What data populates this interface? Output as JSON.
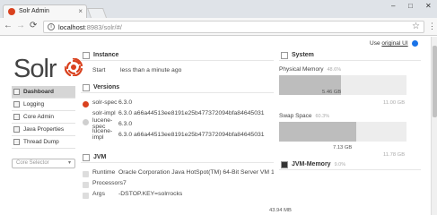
{
  "browser": {
    "tab_title": "Solr Admin",
    "tab_close": "×",
    "win_min": "–",
    "win_max": "□",
    "win_close": "✕",
    "url_host": "localhost",
    "url_path": ":8983/solr/#/",
    "back": "←",
    "forward": "→",
    "reload": "⟳",
    "star": "☆",
    "menu": "⋮",
    "info": "i"
  },
  "header": {
    "use_prefix": "Use ",
    "use_link": "original UI"
  },
  "logo": {
    "text": "Solr"
  },
  "nav": {
    "items": [
      {
        "label": "Dashboard",
        "icon": "dashboard-icon"
      },
      {
        "label": "Logging",
        "icon": "logging-icon"
      },
      {
        "label": "Core Admin",
        "icon": "core-admin-icon"
      },
      {
        "label": "Java Properties",
        "icon": "java-properties-icon"
      },
      {
        "label": "Thread Dump",
        "icon": "thread-dump-icon"
      }
    ],
    "core_selector": "Core Selector",
    "core_selector_arrow": "▾"
  },
  "instance": {
    "title": "Instance",
    "start_label": "Start",
    "start_value": "less than a minute ago"
  },
  "versions": {
    "title": "Versions",
    "rows": [
      {
        "label": "solr-spec",
        "value": "6.3.0"
      },
      {
        "label": "solr-impl",
        "value": "6.3.0 a66a44513ee8191e25b477372094bfa84645031"
      },
      {
        "label": "lucene-spec",
        "value": "6.3.0"
      },
      {
        "label": "lucene-impl",
        "value": "6.3.0 a66a44513ee8191e25b477372094bfa84645031"
      }
    ]
  },
  "jvm": {
    "title": "JVM",
    "rows": [
      {
        "label": "Runtime",
        "value": "Oracle Corporation Java HotSpot(TM) 64-Bit Server VM 1"
      },
      {
        "label": "Processors",
        "value": "7"
      },
      {
        "label": "Args",
        "value": "-DSTOP.KEY=solrrocks"
      }
    ]
  },
  "system": {
    "title": "System",
    "physical_label": "Physical Memory",
    "physical_pct": "48.6%",
    "physical_fraction": 0.486,
    "physical_used": "5.46 GB",
    "physical_total": "11.00 GB",
    "swap_label": "Swap Space",
    "swap_pct": "60.3%",
    "swap_fraction": 0.603,
    "swap_used": "7.13 GB",
    "swap_total": "11.78 GB"
  },
  "jvm_memory": {
    "title": "JVM-Memory",
    "pct": "9.0%",
    "used": "43.94 MB"
  },
  "colors": {
    "accent": "#d9411e",
    "bar_fill": "#bdbdbd",
    "bar_bg": "#ededed"
  }
}
